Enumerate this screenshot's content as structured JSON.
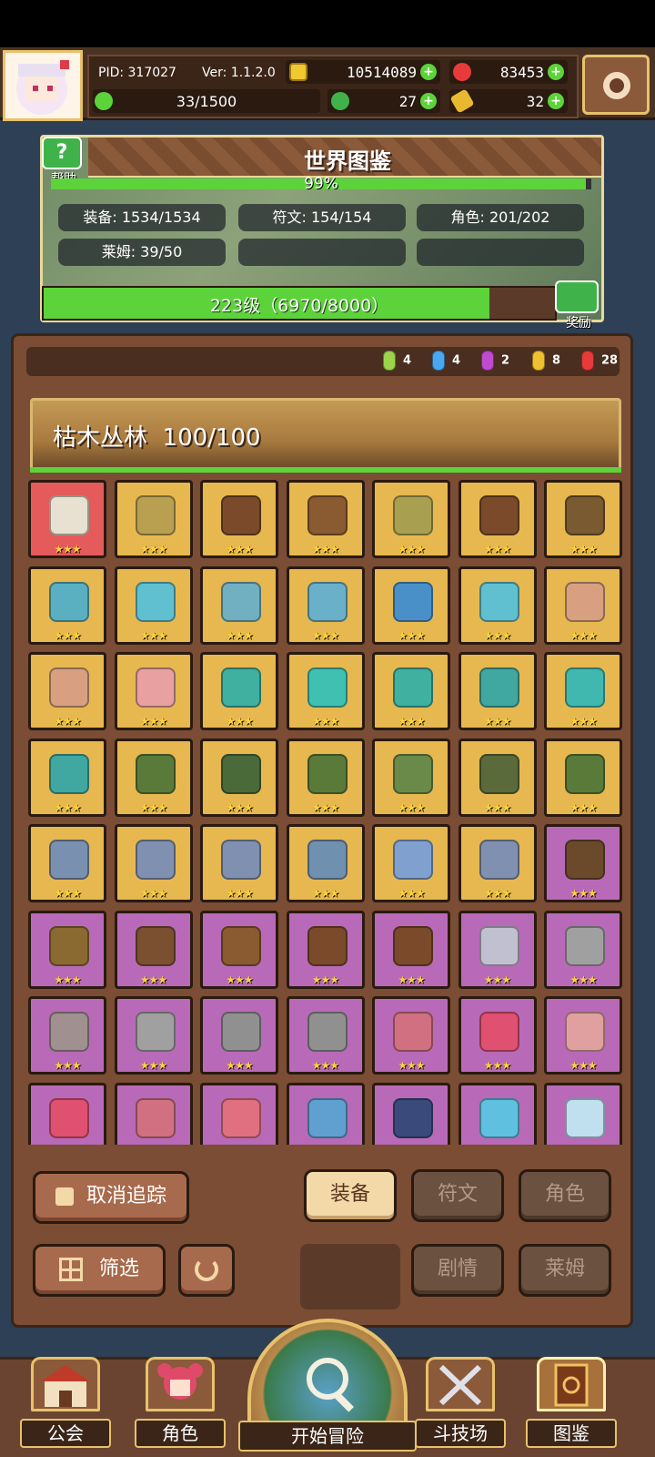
{
  "header": {
    "pid": "PID: 317027",
    "ver": "Ver: 1.1.2.0",
    "gold": "10514089",
    "rubies": "83453",
    "stamina": "33/1500",
    "clover": "27",
    "keys": "32"
  },
  "world": {
    "title": "世界图鉴",
    "help_label": "帮助",
    "percent": "99%",
    "percent_value": 0.99,
    "stats": [
      "装备: 1534/1534",
      "符文: 154/154",
      "角色: 201/202",
      "莱姆: 39/50"
    ],
    "level_text": "223级（6970/8000）",
    "level_progress": 0.87125,
    "reward_label": "奖励"
  },
  "gems": [
    {
      "count": "4",
      "color": "#9bd34a"
    },
    {
      "count": "4",
      "color": "#4aa8f0"
    },
    {
      "count": "2",
      "color": "#c04ad0"
    },
    {
      "count": "8",
      "color": "#f0c030"
    },
    {
      "count": "28",
      "color": "#e83a3a"
    }
  ],
  "zone": {
    "name": "枯木丛林",
    "progress": "100/100"
  },
  "items": [
    {
      "bg": "red",
      "icon": "axe-icon",
      "color": "#e8e0d0"
    },
    {
      "bg": "gold",
      "icon": "wand-icon",
      "color": "#b8a050"
    },
    {
      "bg": "gold",
      "icon": "boot-icon",
      "color": "#7a4a2a"
    },
    {
      "bg": "gold",
      "icon": "amulet-icon",
      "color": "#8a5a30"
    },
    {
      "bg": "gold",
      "icon": "orb-icon",
      "color": "#a8a050"
    },
    {
      "bg": "gold",
      "icon": "necklace-icon",
      "color": "#7a4a2a"
    },
    {
      "bg": "gold",
      "icon": "ring-icon",
      "color": "#7a5a30"
    },
    {
      "bg": "gold",
      "icon": "helmet-icon",
      "color": "#5ab0c0"
    },
    {
      "bg": "gold",
      "icon": "ring-icon",
      "color": "#60c0d0"
    },
    {
      "bg": "gold",
      "icon": "boot-icon",
      "color": "#70b0c0"
    },
    {
      "bg": "gold",
      "icon": "armor-icon",
      "color": "#6ab0c8"
    },
    {
      "bg": "gold",
      "icon": "glove-icon",
      "color": "#4a90c8"
    },
    {
      "bg": "gold",
      "icon": "ring-icon",
      "color": "#60c0d0"
    },
    {
      "bg": "gold",
      "icon": "glove-icon",
      "color": "#d8a080"
    },
    {
      "bg": "gold",
      "icon": "glove-icon",
      "color": "#d8a080"
    },
    {
      "bg": "gold",
      "icon": "necklace-icon",
      "color": "#e8a0a0"
    },
    {
      "bg": "gold",
      "icon": "dagger-icon",
      "color": "#40b0a0"
    },
    {
      "bg": "gold",
      "icon": "gem-icon",
      "color": "#40c0b0"
    },
    {
      "bg": "gold",
      "icon": "bracer-icon",
      "color": "#40b0a0"
    },
    {
      "bg": "gold",
      "icon": "helmet-icon",
      "color": "#40a8a0"
    },
    {
      "bg": "gold",
      "icon": "armor-icon",
      "color": "#40b8b0"
    },
    {
      "bg": "gold",
      "icon": "boot-icon",
      "color": "#40a8a0"
    },
    {
      "bg": "gold",
      "icon": "wand-icon",
      "color": "#5a7a3a"
    },
    {
      "bg": "gold",
      "icon": "amulet-icon",
      "color": "#4a6a3a"
    },
    {
      "bg": "gold",
      "icon": "amulet-icon",
      "color": "#5a7a3a"
    },
    {
      "bg": "gold",
      "icon": "crown-icon",
      "color": "#6a8a4a"
    },
    {
      "bg": "gold",
      "icon": "necklace-icon",
      "color": "#5a6a3a"
    },
    {
      "bg": "gold",
      "icon": "ring-icon",
      "color": "#5a7a3a"
    },
    {
      "bg": "gold",
      "icon": "helmet-icon",
      "color": "#7a90b0"
    },
    {
      "bg": "gold",
      "icon": "ring-icon",
      "color": "#8090b0"
    },
    {
      "bg": "gold",
      "icon": "necklace-icon",
      "color": "#8090b0"
    },
    {
      "bg": "gold",
      "icon": "wand-icon",
      "color": "#7090b0"
    },
    {
      "bg": "gold",
      "icon": "orb-icon",
      "color": "#80a0d0"
    },
    {
      "bg": "gold",
      "icon": "armor-icon",
      "color": "#8090b0"
    },
    {
      "bg": "pink",
      "icon": "necklace-icon",
      "color": "#6a4a2a"
    },
    {
      "bg": "pink",
      "icon": "helmet-icon",
      "color": "#8a6a30"
    },
    {
      "bg": "pink",
      "icon": "amulet-icon",
      "color": "#7a5030"
    },
    {
      "bg": "pink",
      "icon": "wand-icon",
      "color": "#8a5a30"
    },
    {
      "bg": "pink",
      "icon": "bracer-icon",
      "color": "#7a4a2a"
    },
    {
      "bg": "pink",
      "icon": "ring-icon",
      "color": "#7a4a2a"
    },
    {
      "bg": "pink",
      "icon": "sword-icon",
      "color": "#c0c0d0"
    },
    {
      "bg": "pink",
      "icon": "glove-icon",
      "color": "#a0a0a0"
    },
    {
      "bg": "pink",
      "icon": "helmet-icon",
      "color": "#a09090"
    },
    {
      "bg": "pink",
      "icon": "amulet-icon",
      "color": "#a0a0a0"
    },
    {
      "bg": "pink",
      "icon": "helmet-icon",
      "color": "#909090"
    },
    {
      "bg": "pink",
      "icon": "armor-icon",
      "color": "#909090"
    },
    {
      "bg": "pink",
      "icon": "wand-icon",
      "color": "#d07080"
    },
    {
      "bg": "pink",
      "icon": "potion-icon",
      "color": "#e05070"
    },
    {
      "bg": "pink",
      "icon": "armor-icon",
      "color": "#e0a0a0"
    },
    {
      "bg": "pink",
      "icon": "gem-icon",
      "color": "#e05070"
    },
    {
      "bg": "pink",
      "icon": "necklace-icon",
      "color": "#d07080"
    },
    {
      "bg": "pink",
      "icon": "ring-icon",
      "color": "#e07080"
    },
    {
      "bg": "pink",
      "icon": "wand-icon",
      "color": "#60a0d0"
    },
    {
      "bg": "pink",
      "icon": "boot-icon",
      "color": "#3a4a7a"
    },
    {
      "bg": "pink",
      "icon": "gem-icon",
      "color": "#60c0e0"
    },
    {
      "bg": "pink",
      "icon": "cloud-icon",
      "color": "#c0e0f0"
    }
  ],
  "stars": "★★★",
  "buttons": {
    "untrack": "取消追踪",
    "filter": "筛选",
    "equip": "装备",
    "rune": "符文",
    "role": "角色",
    "story": "剧情",
    "slime": "莱姆"
  },
  "nav": {
    "guild": "公会",
    "character": "角色",
    "adventure": "开始冒险",
    "arena": "斗技场",
    "codex": "图鉴"
  }
}
